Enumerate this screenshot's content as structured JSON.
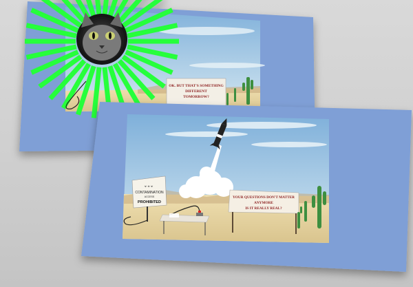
{
  "scene": {
    "back_card": {
      "sign_text_lines": [
        "OK. BUT THAT'S SOMETHING",
        "DIFFERENT",
        "TOMORROW?"
      ]
    },
    "front_card": {
      "warning_sign_lines": [
        "CONTAMINATION",
        "ACCESS",
        "PROHIBITED"
      ],
      "billboard_lines": [
        "YOUR QUESTIONS DON'T MATTER",
        "ANYMORE",
        "IS IT REALLY REAL?"
      ]
    }
  },
  "colors": {
    "background": "#d3d3d3",
    "envelope_blue": "#7f9fd6",
    "sky_top": "#87b7dc",
    "sky_bottom": "#cfe4ef",
    "desert_sand": "#e9d9a6",
    "ray_green": "#26ff3a",
    "cactus_green": "#3e8f3f"
  },
  "icons": {
    "cat": "cat-face-icon",
    "rocket": "rocket-icon",
    "plunger": "detonator-icon"
  }
}
